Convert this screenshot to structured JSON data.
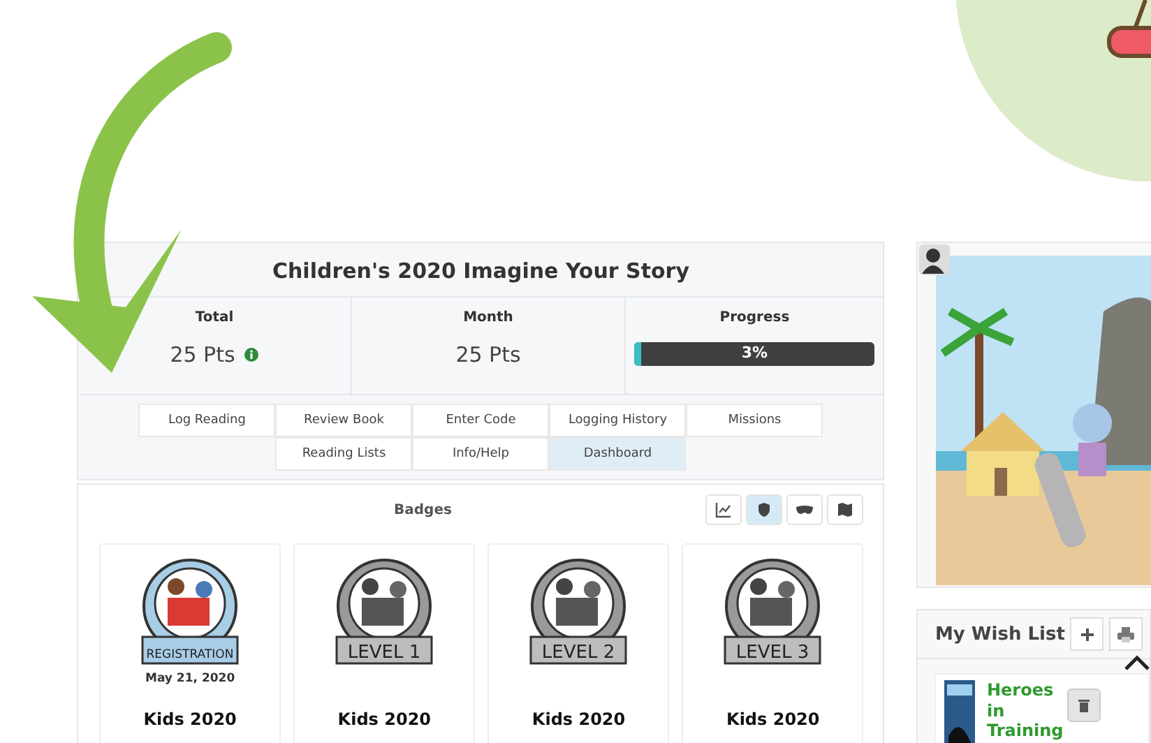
{
  "header": {
    "title": "Children's 2020 Imagine Your Story"
  },
  "stats": [
    {
      "label": "Total",
      "value": "25 Pts",
      "info": true
    },
    {
      "label": "Month",
      "value": "25 Pts",
      "info": false
    }
  ],
  "progress": {
    "label": "Progress",
    "level": 0.03,
    "reading": "3%"
  },
  "nav_tabs": [
    {
      "label": "Log Reading",
      "selected": false
    },
    {
      "label": "Review Book",
      "selected": false
    },
    {
      "label": "Enter Code",
      "selected": false
    },
    {
      "label": "Logging History",
      "selected": false
    },
    {
      "label": "Missions",
      "selected": false
    },
    {
      "label": "Reading Lists",
      "selected": false
    },
    {
      "label": "Info/Help",
      "selected": false
    },
    {
      "label": "Dashboard",
      "selected": true
    }
  ],
  "badges": {
    "title": "Badges",
    "views": [
      {
        "kind": "chart",
        "selected": false
      },
      {
        "kind": "shield",
        "selected": true
      },
      {
        "kind": "mask",
        "selected": false
      },
      {
        "kind": "map",
        "selected": false
      }
    ],
    "items": [
      {
        "emblem": "REGISTRATION",
        "earned": true,
        "date": "May 21, 2020",
        "name": "Kids 2020"
      },
      {
        "emblem": "LEVEL 1",
        "earned": false,
        "name": "Kids 2020"
      },
      {
        "emblem": "LEVEL 2",
        "earned": false,
        "name": "Kids 2020"
      },
      {
        "emblem": "LEVEL 3",
        "earned": false,
        "name": "Kids 2020"
      }
    ]
  },
  "wish_list": {
    "title": "My Wish List",
    "items": [
      {
        "title": "Heroes in Training"
      }
    ]
  }
}
